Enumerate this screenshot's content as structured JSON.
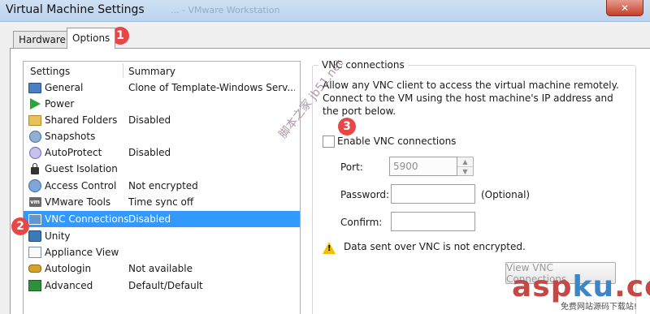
{
  "window": {
    "title": "Virtual Machine Settings",
    "background_title": "... - VMware Workstation",
    "close_glyph": "✕"
  },
  "tabs": [
    {
      "label": "Hardware"
    },
    {
      "label": "Options"
    }
  ],
  "settings_list": {
    "headers": {
      "settings": "Settings",
      "summary": "Summary"
    },
    "rows": [
      {
        "label": "General",
        "summary": "Clone of Template-Windows Serv...",
        "icon": "monitor-icon"
      },
      {
        "label": "Power",
        "summary": "",
        "icon": "play-icon"
      },
      {
        "label": "Shared Folders",
        "summary": "Disabled",
        "icon": "folder-icon"
      },
      {
        "label": "Snapshots",
        "summary": "",
        "icon": "camera-icon"
      },
      {
        "label": "AutoProtect",
        "summary": "Disabled",
        "icon": "shield-icon"
      },
      {
        "label": "Guest Isolation",
        "summary": "",
        "icon": "lock-icon"
      },
      {
        "label": "Access Control",
        "summary": "Not encrypted",
        "icon": "users-icon"
      },
      {
        "label": "VMware Tools",
        "summary": "Time sync off",
        "icon": "vm-icon"
      },
      {
        "label": "VNC Connections",
        "summary": "Disabled",
        "icon": "vnc-icon",
        "selected": true
      },
      {
        "label": "Unity",
        "summary": "",
        "icon": "unity-icon"
      },
      {
        "label": "Appliance View",
        "summary": "",
        "icon": "appliance-icon"
      },
      {
        "label": "Autologin",
        "summary": "Not available",
        "icon": "key-icon"
      },
      {
        "label": "Advanced",
        "summary": "Default/Default",
        "icon": "advanced-icon"
      }
    ]
  },
  "vnc": {
    "group_title": "VNC connections",
    "description": "Allow any VNC client to access the virtual machine remotely. Connect to the VM using the host machine's IP address and the port below.",
    "enable_label": "Enable VNC connections",
    "enable_checked": false,
    "port_label": "Port:",
    "port_value": "5900",
    "password_label": "Password:",
    "password_value": "",
    "optional_label": "(Optional)",
    "confirm_label": "Confirm:",
    "confirm_value": "",
    "warning_text": "Data sent over VNC is not encrypted.",
    "view_button_label": "View VNC Connections"
  },
  "callouts": [
    "1",
    "2",
    "3"
  ],
  "watermarks": {
    "vertical": "脚本之家 jb51.net",
    "logo_main": "asp",
    "logo_accent": "ku",
    "logo_tld": ".com",
    "logo_sub": "免费网站源码下载站!"
  },
  "colors": {
    "selection": "#3399ff",
    "callout": "#e74747",
    "warning": "#f0c000"
  }
}
